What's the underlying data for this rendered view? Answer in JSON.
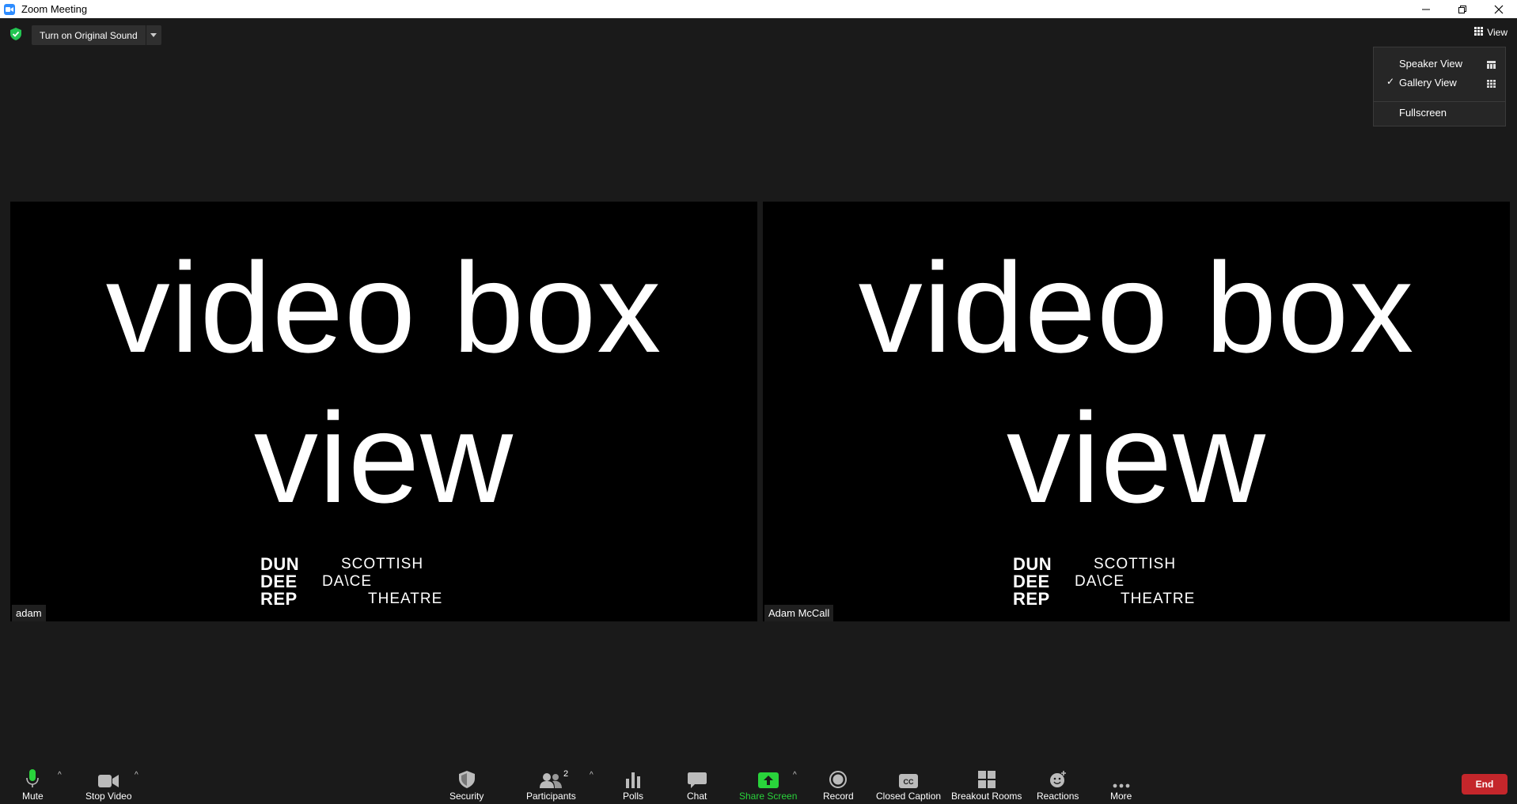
{
  "window": {
    "title": "Zoom Meeting",
    "controls": [
      "minimize",
      "restore",
      "close"
    ]
  },
  "topbar": {
    "original_sound_label": "Turn on Original Sound",
    "view_label": "View"
  },
  "view_menu": {
    "items": [
      {
        "label": "Speaker View",
        "checked": false,
        "icon": "speaker-grid-icon"
      },
      {
        "label": "Gallery View",
        "checked": true,
        "icon": "gallery-grid-icon"
      },
      {
        "label": "Fullscreen",
        "checked": false
      }
    ],
    "check_mark": "✓"
  },
  "tiles": [
    {
      "name": "adam",
      "line1": "video box",
      "line2": "view",
      "logo_left": [
        "DUN",
        "DEE",
        "REP"
      ],
      "logo_right": [
        "SCOTTISH",
        "DA\\CE",
        "THEATRE"
      ]
    },
    {
      "name": "Adam McCall",
      "line1": "video box",
      "line2": "view",
      "logo_left": [
        "DUN",
        "DEE",
        "REP"
      ],
      "logo_right": [
        "SCOTTISH",
        "DA\\CE",
        "THEATRE"
      ]
    }
  ],
  "toolbar": {
    "mute": "Mute",
    "stop_video": "Stop Video",
    "security": "Security",
    "participants": "Participants",
    "participants_count": "2",
    "polls": "Polls",
    "chat": "Chat",
    "share_screen": "Share Screen",
    "record": "Record",
    "closed_caption": "Closed Caption",
    "breakout_rooms": "Breakout Rooms",
    "reactions": "Reactions",
    "more": "More",
    "end": "End"
  },
  "colors": {
    "background": "#1a1a1a",
    "share_green": "#29d33b",
    "end_red": "#c4262b",
    "zoom_blue": "#2d8cff"
  }
}
